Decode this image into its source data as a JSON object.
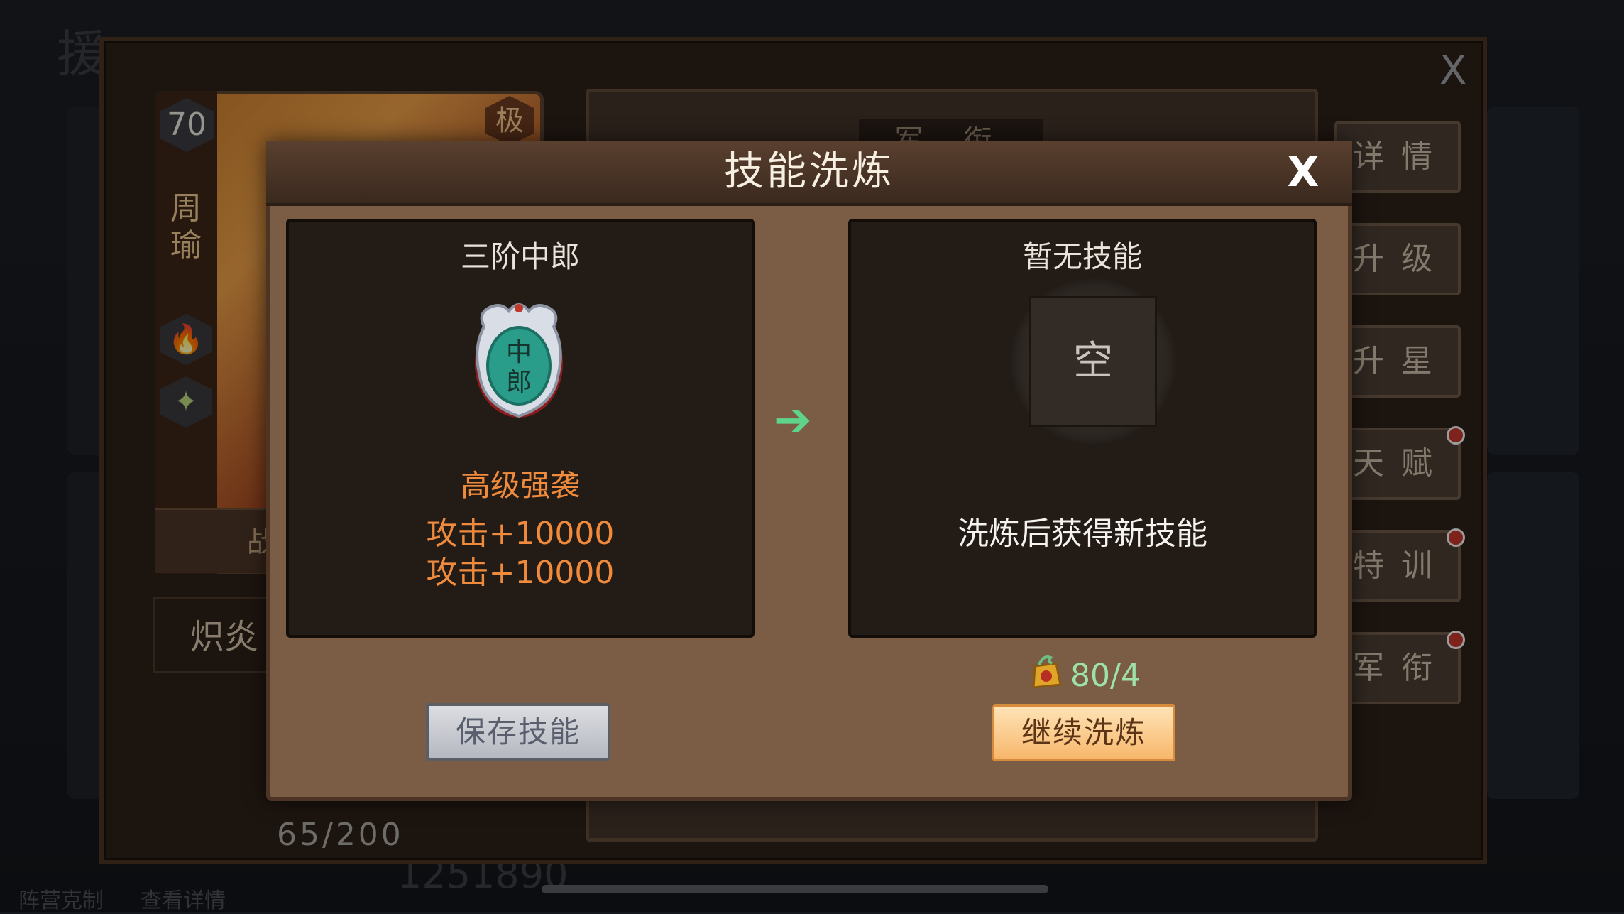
{
  "background": {
    "title": "援",
    "footer": {
      "camp_counter": "阵营克制",
      "view_details": "查看详情",
      "power": "1251890"
    },
    "hero": {
      "level": "70",
      "name": "周瑜",
      "rank_badge": "极",
      "battle_button": "战",
      "skill_slot": "炽炎",
      "exp": "65/200",
      "info_header": "军 衔"
    },
    "side_buttons": [
      {
        "label": "详情",
        "dot": false
      },
      {
        "label": "升级",
        "dot": false
      },
      {
        "label": "升星",
        "dot": false
      },
      {
        "label": "天赋",
        "dot": true
      },
      {
        "label": "特训",
        "dot": true
      },
      {
        "label": "军衔",
        "dot": true
      }
    ],
    "close_label": "X"
  },
  "modal": {
    "title": "技能洗炼",
    "close_label": "X",
    "current": {
      "title": "三阶中郎",
      "icon_text_top": "中",
      "icon_text_bottom": "郎",
      "skill_name": "高级强袭",
      "attributes": [
        "攻击+10000",
        "攻击+10000"
      ]
    },
    "arrow": "➔",
    "result": {
      "title": "暂无技能",
      "empty_label": "空",
      "hint": "洗炼后获得新技能"
    },
    "cost": {
      "value": "80/4",
      "icon": "refine-stone-icon"
    },
    "save_button": "保存技能",
    "continue_button": "继续洗炼"
  },
  "colors": {
    "accent_orange": "#f08a3c",
    "cost_green": "#9ee2a8",
    "arrow_green": "#5fd38a"
  }
}
